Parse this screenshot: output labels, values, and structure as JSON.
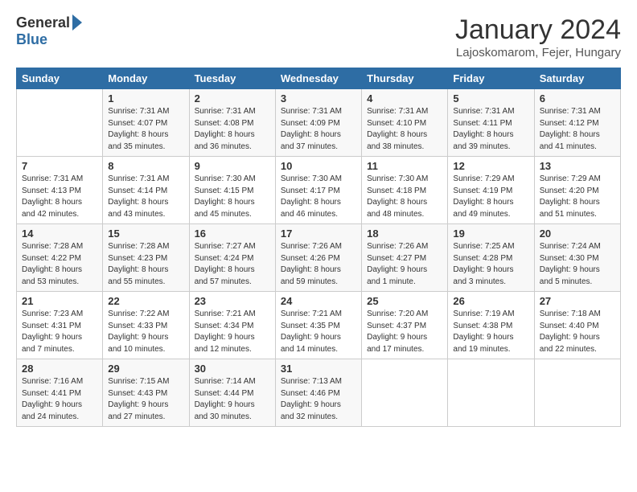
{
  "logo": {
    "general": "General",
    "blue": "Blue"
  },
  "header": {
    "title": "January 2024",
    "location": "Lajoskomarom, Fejer, Hungary"
  },
  "days_of_week": [
    "Sunday",
    "Monday",
    "Tuesday",
    "Wednesday",
    "Thursday",
    "Friday",
    "Saturday"
  ],
  "weeks": [
    [
      {
        "day": "",
        "sunrise": "",
        "sunset": "",
        "daylight": ""
      },
      {
        "day": "1",
        "sunrise": "Sunrise: 7:31 AM",
        "sunset": "Sunset: 4:07 PM",
        "daylight": "Daylight: 8 hours and 35 minutes."
      },
      {
        "day": "2",
        "sunrise": "Sunrise: 7:31 AM",
        "sunset": "Sunset: 4:08 PM",
        "daylight": "Daylight: 8 hours and 36 minutes."
      },
      {
        "day": "3",
        "sunrise": "Sunrise: 7:31 AM",
        "sunset": "Sunset: 4:09 PM",
        "daylight": "Daylight: 8 hours and 37 minutes."
      },
      {
        "day": "4",
        "sunrise": "Sunrise: 7:31 AM",
        "sunset": "Sunset: 4:10 PM",
        "daylight": "Daylight: 8 hours and 38 minutes."
      },
      {
        "day": "5",
        "sunrise": "Sunrise: 7:31 AM",
        "sunset": "Sunset: 4:11 PM",
        "daylight": "Daylight: 8 hours and 39 minutes."
      },
      {
        "day": "6",
        "sunrise": "Sunrise: 7:31 AM",
        "sunset": "Sunset: 4:12 PM",
        "daylight": "Daylight: 8 hours and 41 minutes."
      }
    ],
    [
      {
        "day": "7",
        "sunrise": "Sunrise: 7:31 AM",
        "sunset": "Sunset: 4:13 PM",
        "daylight": "Daylight: 8 hours and 42 minutes."
      },
      {
        "day": "8",
        "sunrise": "Sunrise: 7:31 AM",
        "sunset": "Sunset: 4:14 PM",
        "daylight": "Daylight: 8 hours and 43 minutes."
      },
      {
        "day": "9",
        "sunrise": "Sunrise: 7:30 AM",
        "sunset": "Sunset: 4:15 PM",
        "daylight": "Daylight: 8 hours and 45 minutes."
      },
      {
        "day": "10",
        "sunrise": "Sunrise: 7:30 AM",
        "sunset": "Sunset: 4:17 PM",
        "daylight": "Daylight: 8 hours and 46 minutes."
      },
      {
        "day": "11",
        "sunrise": "Sunrise: 7:30 AM",
        "sunset": "Sunset: 4:18 PM",
        "daylight": "Daylight: 8 hours and 48 minutes."
      },
      {
        "day": "12",
        "sunrise": "Sunrise: 7:29 AM",
        "sunset": "Sunset: 4:19 PM",
        "daylight": "Daylight: 8 hours and 49 minutes."
      },
      {
        "day": "13",
        "sunrise": "Sunrise: 7:29 AM",
        "sunset": "Sunset: 4:20 PM",
        "daylight": "Daylight: 8 hours and 51 minutes."
      }
    ],
    [
      {
        "day": "14",
        "sunrise": "Sunrise: 7:28 AM",
        "sunset": "Sunset: 4:22 PM",
        "daylight": "Daylight: 8 hours and 53 minutes."
      },
      {
        "day": "15",
        "sunrise": "Sunrise: 7:28 AM",
        "sunset": "Sunset: 4:23 PM",
        "daylight": "Daylight: 8 hours and 55 minutes."
      },
      {
        "day": "16",
        "sunrise": "Sunrise: 7:27 AM",
        "sunset": "Sunset: 4:24 PM",
        "daylight": "Daylight: 8 hours and 57 minutes."
      },
      {
        "day": "17",
        "sunrise": "Sunrise: 7:26 AM",
        "sunset": "Sunset: 4:26 PM",
        "daylight": "Daylight: 8 hours and 59 minutes."
      },
      {
        "day": "18",
        "sunrise": "Sunrise: 7:26 AM",
        "sunset": "Sunset: 4:27 PM",
        "daylight": "Daylight: 9 hours and 1 minute."
      },
      {
        "day": "19",
        "sunrise": "Sunrise: 7:25 AM",
        "sunset": "Sunset: 4:28 PM",
        "daylight": "Daylight: 9 hours and 3 minutes."
      },
      {
        "day": "20",
        "sunrise": "Sunrise: 7:24 AM",
        "sunset": "Sunset: 4:30 PM",
        "daylight": "Daylight: 9 hours and 5 minutes."
      }
    ],
    [
      {
        "day": "21",
        "sunrise": "Sunrise: 7:23 AM",
        "sunset": "Sunset: 4:31 PM",
        "daylight": "Daylight: 9 hours and 7 minutes."
      },
      {
        "day": "22",
        "sunrise": "Sunrise: 7:22 AM",
        "sunset": "Sunset: 4:33 PM",
        "daylight": "Daylight: 9 hours and 10 minutes."
      },
      {
        "day": "23",
        "sunrise": "Sunrise: 7:21 AM",
        "sunset": "Sunset: 4:34 PM",
        "daylight": "Daylight: 9 hours and 12 minutes."
      },
      {
        "day": "24",
        "sunrise": "Sunrise: 7:21 AM",
        "sunset": "Sunset: 4:35 PM",
        "daylight": "Daylight: 9 hours and 14 minutes."
      },
      {
        "day": "25",
        "sunrise": "Sunrise: 7:20 AM",
        "sunset": "Sunset: 4:37 PM",
        "daylight": "Daylight: 9 hours and 17 minutes."
      },
      {
        "day": "26",
        "sunrise": "Sunrise: 7:19 AM",
        "sunset": "Sunset: 4:38 PM",
        "daylight": "Daylight: 9 hours and 19 minutes."
      },
      {
        "day": "27",
        "sunrise": "Sunrise: 7:18 AM",
        "sunset": "Sunset: 4:40 PM",
        "daylight": "Daylight: 9 hours and 22 minutes."
      }
    ],
    [
      {
        "day": "28",
        "sunrise": "Sunrise: 7:16 AM",
        "sunset": "Sunset: 4:41 PM",
        "daylight": "Daylight: 9 hours and 24 minutes."
      },
      {
        "day": "29",
        "sunrise": "Sunrise: 7:15 AM",
        "sunset": "Sunset: 4:43 PM",
        "daylight": "Daylight: 9 hours and 27 minutes."
      },
      {
        "day": "30",
        "sunrise": "Sunrise: 7:14 AM",
        "sunset": "Sunset: 4:44 PM",
        "daylight": "Daylight: 9 hours and 30 minutes."
      },
      {
        "day": "31",
        "sunrise": "Sunrise: 7:13 AM",
        "sunset": "Sunset: 4:46 PM",
        "daylight": "Daylight: 9 hours and 32 minutes."
      },
      {
        "day": "",
        "sunrise": "",
        "sunset": "",
        "daylight": ""
      },
      {
        "day": "",
        "sunrise": "",
        "sunset": "",
        "daylight": ""
      },
      {
        "day": "",
        "sunrise": "",
        "sunset": "",
        "daylight": ""
      }
    ]
  ]
}
